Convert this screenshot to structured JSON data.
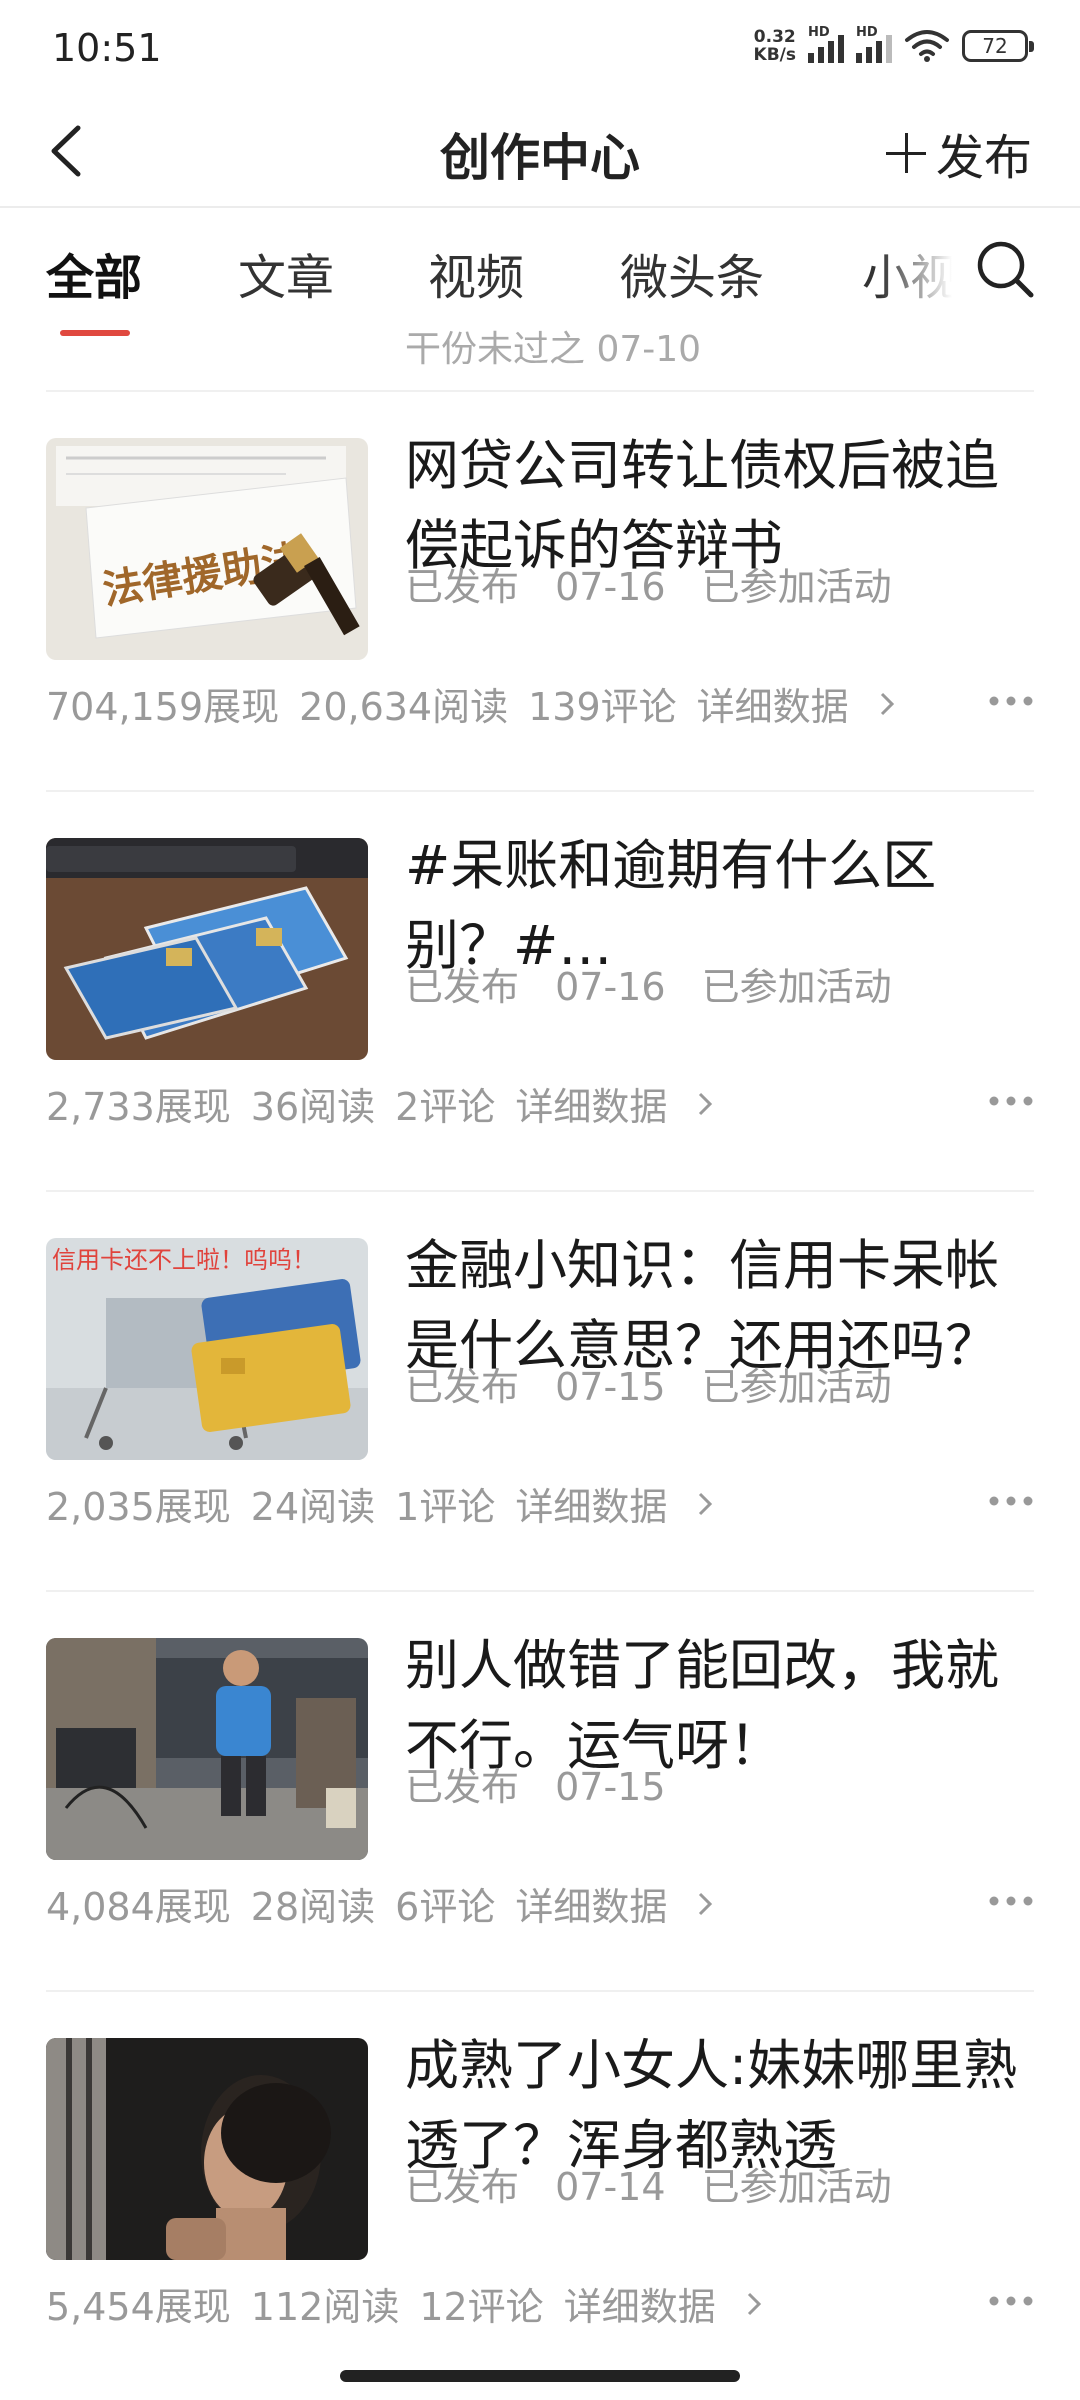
{
  "status_bar": {
    "time": "10:51",
    "net_speed_value": "0.32",
    "net_speed_unit": "KB/s",
    "signal_label_1": "HD",
    "signal_label_2": "HD",
    "battery": "72"
  },
  "header": {
    "title": "创作中心",
    "publish_label": "发布"
  },
  "tabs": [
    {
      "label": "全部",
      "active": true
    },
    {
      "label": "文章",
      "active": false
    },
    {
      "label": "视频",
      "active": false
    },
    {
      "label": "微头条",
      "active": false
    },
    {
      "label": "小视",
      "active": false
    }
  ],
  "accent_color": "#e0493f",
  "peek_text": "干份未过之 07-10",
  "items": [
    {
      "title": "网贷公司转让债权后被追偿起诉的答辩书",
      "status": "已发布",
      "date": "07-16",
      "activity": "已参加活动",
      "views": "704,159展现",
      "reads": "20,634阅读",
      "comments": "139评论",
      "detail": "详细数据",
      "thumb_text": "法律援助法"
    },
    {
      "title": "#呆账和逾期有什么区别？#…",
      "status": "已发布",
      "date": "07-16",
      "activity": "已参加活动",
      "views": "2,733展现",
      "reads": "36阅读",
      "comments": "2评论",
      "detail": "详细数据"
    },
    {
      "title": "金融小知识：信用卡呆帐是什么意思？还用还吗？",
      "status": "已发布",
      "date": "07-15",
      "activity": "已参加活动",
      "views": "2,035展现",
      "reads": "24阅读",
      "comments": "1评论",
      "detail": "详细数据",
      "thumb_text": "信用卡还不上啦！呜呜！"
    },
    {
      "title": "别人做错了能回改，我就不行。运气呀！",
      "status": "已发布",
      "date": "07-15",
      "activity": "",
      "views": "4,084展现",
      "reads": "28阅读",
      "comments": "6评论",
      "detail": "详细数据"
    },
    {
      "title": "成熟了小女人:妹妹哪里熟透了？浑身都熟透",
      "status": "已发布",
      "date": "07-14",
      "activity": "已参加活动",
      "views": "5,454展现",
      "reads": "112阅读",
      "comments": "12评论",
      "detail": "详细数据"
    }
  ]
}
